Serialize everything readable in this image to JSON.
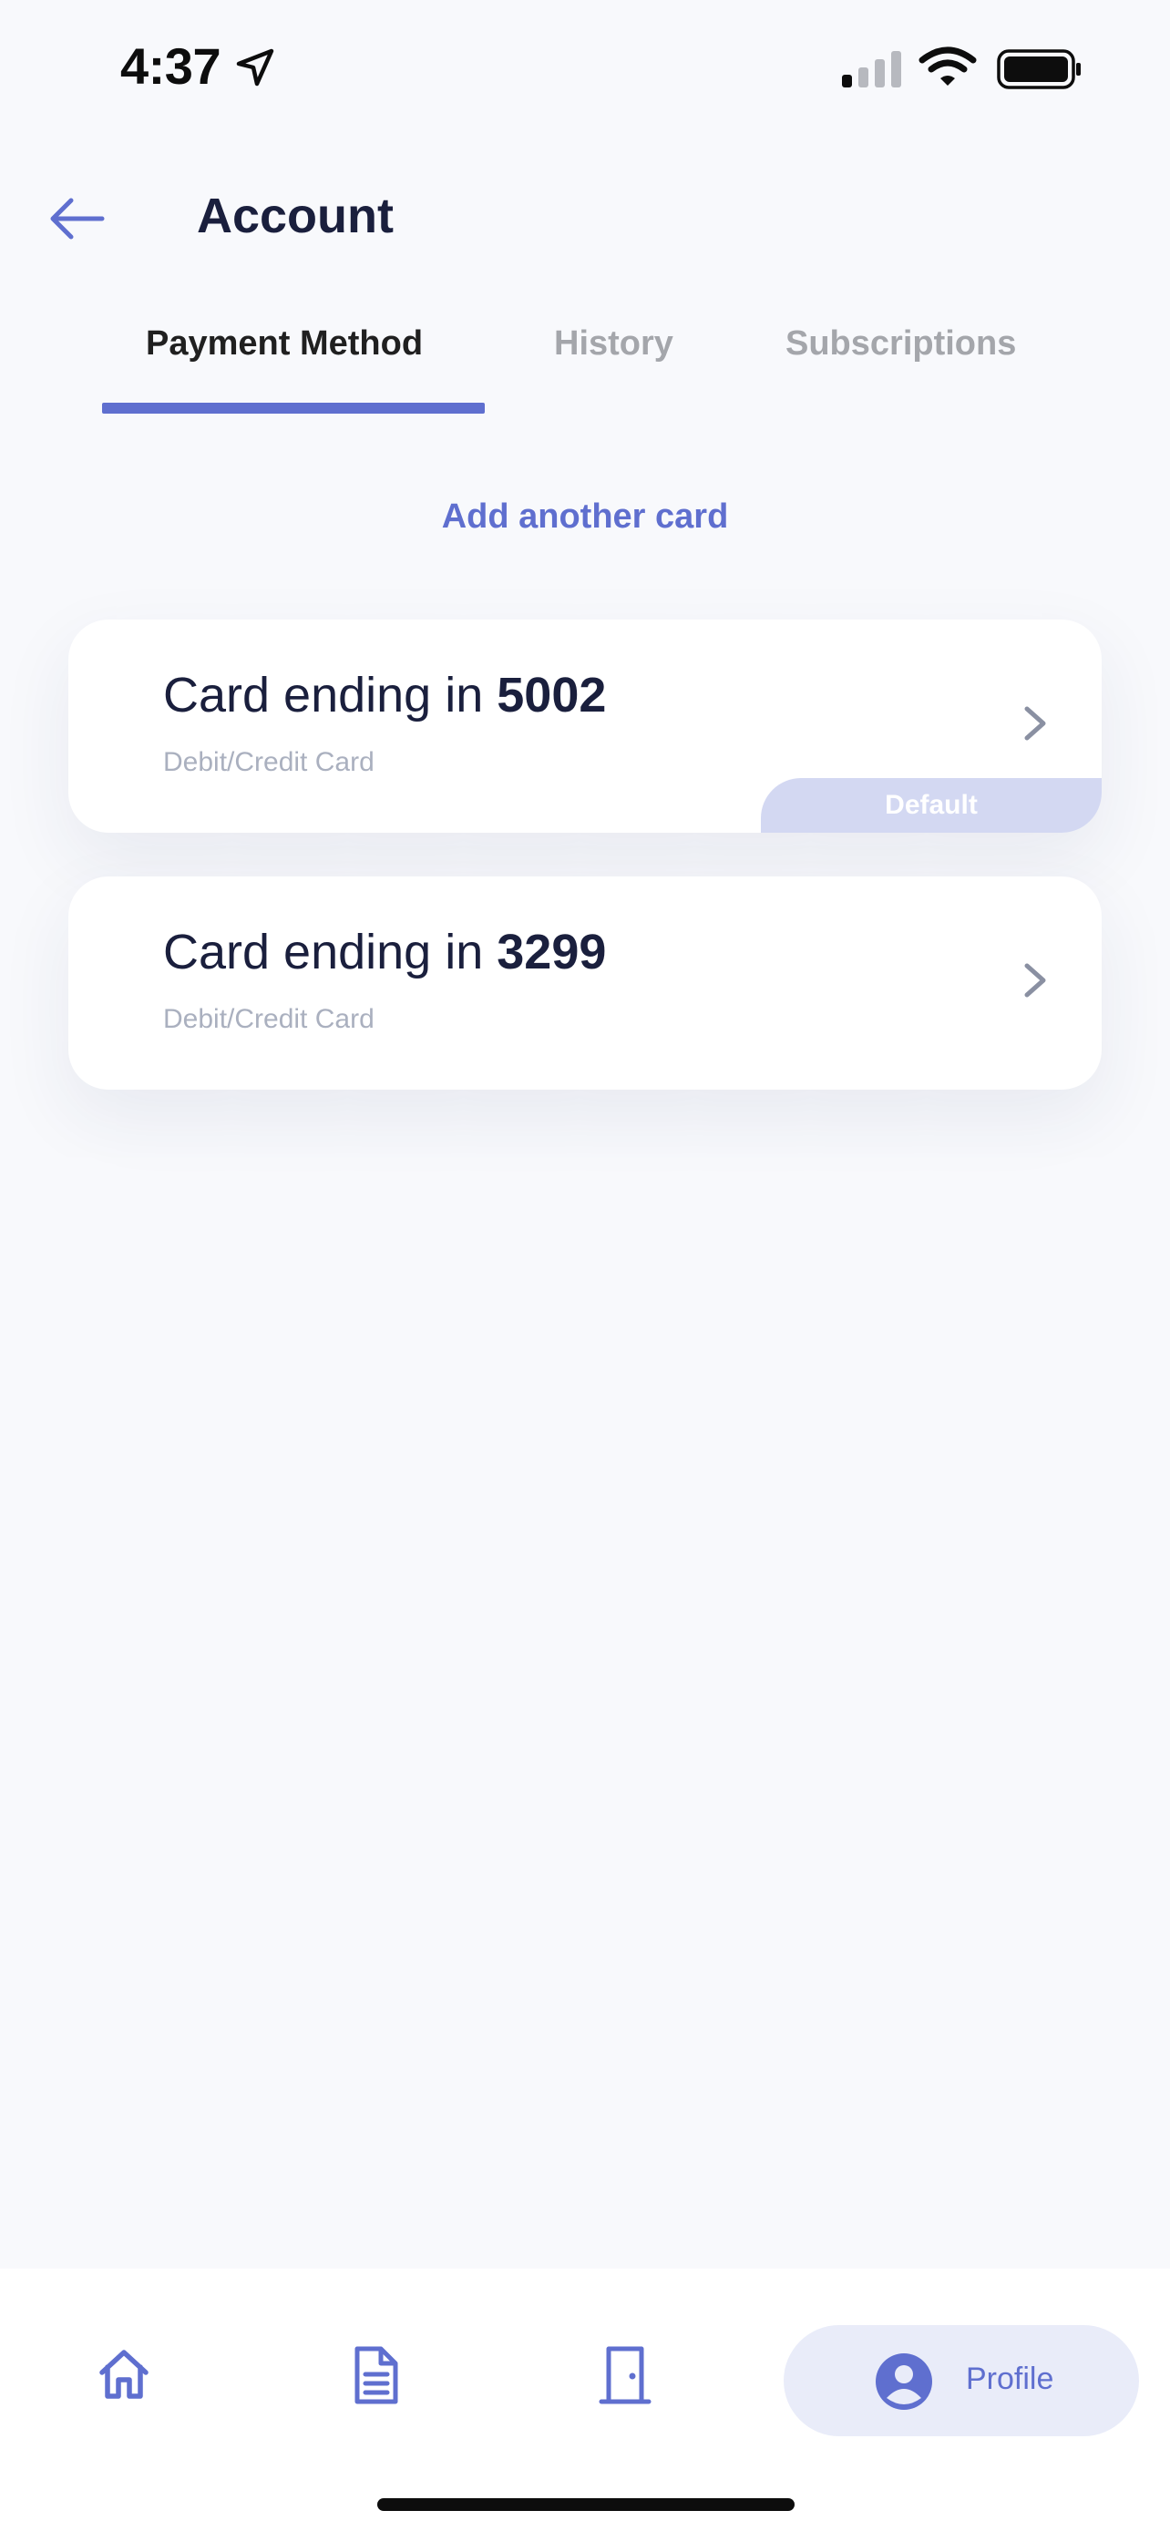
{
  "status_bar": {
    "time": "4:37"
  },
  "header": {
    "title": "Account"
  },
  "tabs": [
    {
      "label": "Payment Method",
      "active": true
    },
    {
      "label": "History",
      "active": false
    },
    {
      "label": "Subscriptions",
      "active": false
    }
  ],
  "add_card_label": "Add another card",
  "cards": [
    {
      "prefix": "Card ending in ",
      "last4": "5002",
      "type": "Debit/Credit Card",
      "badge": "Default"
    },
    {
      "prefix": "Card ending in ",
      "last4": "3299",
      "type": "Debit/Credit Card"
    }
  ],
  "nav": {
    "profile_label": "Profile"
  },
  "colors": {
    "accent": "#5f6fcf",
    "background": "#f8f9fc",
    "badge": "#d3d8f2",
    "title": "#1a1f3d"
  }
}
